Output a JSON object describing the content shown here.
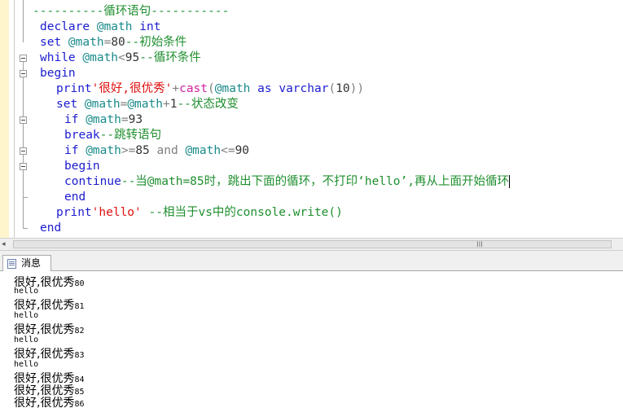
{
  "editor": {
    "lines": [
      [
        [
          "cm",
          "----------循环语句-----------"
        ]
      ],
      [
        [
          "kw",
          "declare "
        ],
        [
          "var",
          "@math "
        ],
        [
          "kw",
          "int"
        ]
      ],
      [
        [
          "kw",
          "set "
        ],
        [
          "var",
          "@math"
        ],
        [
          "op",
          "="
        ],
        [
          "num",
          "80"
        ],
        [
          "cm",
          "--初始条件"
        ]
      ],
      [
        [
          "kw",
          "while "
        ],
        [
          "var",
          "@math"
        ],
        [
          "op",
          "<"
        ],
        [
          "num",
          "95"
        ],
        [
          "cm",
          "--循环条件"
        ]
      ],
      [
        [
          "kw",
          "begin"
        ]
      ],
      [
        [
          "kw",
          "print"
        ],
        [
          "str",
          "'很好,很优秀'"
        ],
        [
          "op",
          "+"
        ],
        [
          "fn",
          "cast"
        ],
        [
          "op",
          "("
        ],
        [
          "var",
          "@math "
        ],
        [
          "kw",
          "as "
        ],
        [
          "kw",
          "varchar"
        ],
        [
          "op",
          "("
        ],
        [
          "num",
          "10"
        ],
        [
          "op",
          "))"
        ]
      ],
      [
        [
          "kw",
          "set "
        ],
        [
          "var",
          "@math"
        ],
        [
          "op",
          "="
        ],
        [
          "var",
          "@math"
        ],
        [
          "op",
          "+"
        ],
        [
          "num",
          "1"
        ],
        [
          "cm",
          "--状态改变"
        ]
      ],
      [
        [
          "kw",
          "if "
        ],
        [
          "var",
          "@math"
        ],
        [
          "op",
          "="
        ],
        [
          "num",
          "93"
        ]
      ],
      [
        [
          "kw",
          "break"
        ],
        [
          "cm",
          "--跳转语句"
        ]
      ],
      [
        [
          "kw",
          "if "
        ],
        [
          "var",
          "@math"
        ],
        [
          "op",
          ">="
        ],
        [
          "num",
          "85 "
        ],
        [
          "op",
          "and "
        ],
        [
          "var",
          "@math"
        ],
        [
          "op",
          "<="
        ],
        [
          "num",
          "90"
        ]
      ],
      [
        [
          "kw",
          "begin"
        ]
      ],
      [
        [
          "kw",
          "continue"
        ],
        [
          "cm",
          "--当@math=85时，跳出下面的循环，不打印‘hello’,再从上面开始循环"
        ]
      ],
      [
        [
          "kw",
          "end"
        ]
      ],
      [
        [
          "kw",
          "print"
        ],
        [
          "str",
          "'hello' "
        ],
        [
          "cm",
          "--相当于vs中的console.write()"
        ]
      ],
      [
        [
          "kw",
          "end"
        ]
      ]
    ]
  },
  "hscroll": {
    "left_arrow": "◂",
    "grip": "III"
  },
  "results_tab": {
    "label": "消息"
  },
  "messages": {
    "items": [
      {
        "kind": "cn",
        "text": "很好,很优秀",
        "num": "80"
      },
      {
        "kind": "en",
        "text": "hello"
      },
      {
        "kind": "cn",
        "text": "很好,很优秀",
        "num": "81"
      },
      {
        "kind": "en",
        "text": "hello"
      },
      {
        "kind": "cn",
        "text": "很好,很优秀",
        "num": "82"
      },
      {
        "kind": "en",
        "text": "hello"
      },
      {
        "kind": "cn",
        "text": "很好,很优秀",
        "num": "83"
      },
      {
        "kind": "en",
        "text": "hello"
      },
      {
        "kind": "cn",
        "text": "很好,很优秀",
        "num": "84"
      },
      {
        "kind": "cn",
        "text": "很好,很优秀",
        "num": "85"
      },
      {
        "kind": "cn",
        "text": "很好,很优秀",
        "num": "86"
      }
    ]
  },
  "colors": {
    "keyword": "#1c1cd0",
    "variable": "#1a8a8a",
    "comment": "#1f8f2f",
    "string": "#e01010",
    "function": "#d020a0"
  }
}
